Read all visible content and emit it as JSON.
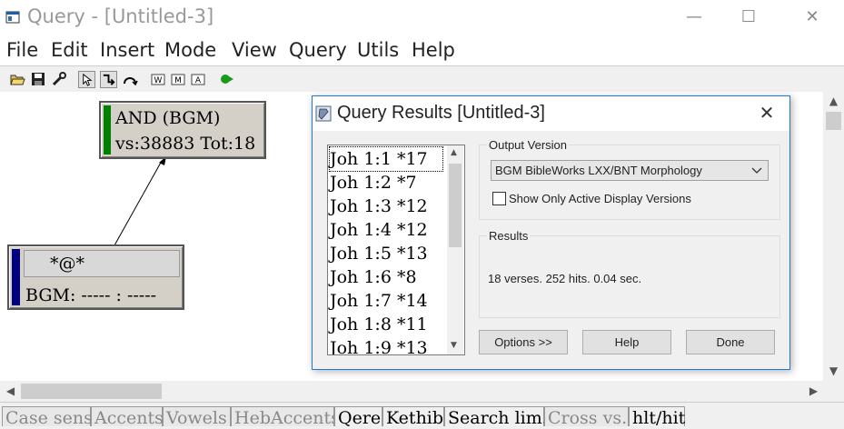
{
  "window": {
    "title": "Query - [Untitled-3]",
    "minimize": "—",
    "maximize": "☐",
    "close": "✕"
  },
  "menu": [
    "File",
    "Edit",
    "Insert",
    "Mode",
    "View",
    "Query",
    "Utils",
    "Help"
  ],
  "toolbar": {
    "icons": [
      "open-folder-icon",
      "save-icon",
      "wrench-icon",
      "pointer-icon",
      "link-icon",
      "curved-link-icon",
      "w-icon",
      "m-icon",
      "a-icon",
      "run-query-icon"
    ],
    "w_label": "W",
    "m_label": "M",
    "a_label": "A"
  },
  "nodes": {
    "and_node": {
      "line1": "AND (BGM)",
      "line2": "vs:38883 Tot:18",
      "accent": "#008000"
    },
    "word_node": {
      "line1": "*@*",
      "line2": "BGM: ----- : -----",
      "accent": "#000080"
    }
  },
  "status_tabs": [
    {
      "label": "Case sens",
      "active": false
    },
    {
      "label": "Accents",
      "active": false
    },
    {
      "label": "Vowels",
      "active": false
    },
    {
      "label": "HebAccents",
      "active": false
    },
    {
      "label": "Qere",
      "active": true
    },
    {
      "label": "Kethib",
      "active": true
    },
    {
      "label": "Search lim.",
      "active": true
    },
    {
      "label": "Cross vs.",
      "active": false
    },
    {
      "label": "hlt/hit",
      "active": true
    }
  ],
  "dialog": {
    "title": "Query Results [Untitled-3]",
    "close": "✕",
    "verses": [
      "Joh 1:1 *17",
      "Joh 1:2 *7",
      "Joh 1:3 *12",
      "Joh 1:4 *12",
      "Joh 1:5 *13",
      "Joh 1:6 *8",
      "Joh 1:7 *14",
      "Joh 1:8 *11",
      "Joh 1:9 *13"
    ],
    "output_version_label": "Output Version",
    "output_version_value": "BGM BibleWorks LXX/BNT Morphology",
    "show_active_label": "Show Only Active Display Versions",
    "show_active_checked": false,
    "results_label": "Results",
    "results_text": "18 verses. 252 hits. 0.04 sec.",
    "buttons": {
      "options": "Options >>",
      "help": "Help",
      "done": "Done"
    }
  }
}
